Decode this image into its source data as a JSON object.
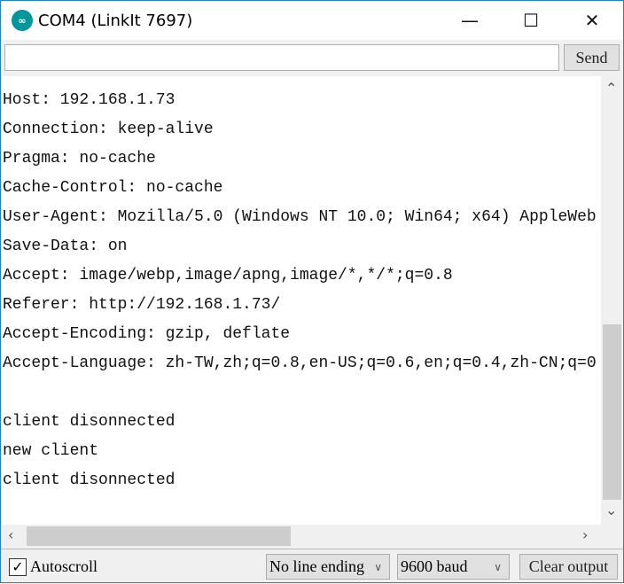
{
  "window": {
    "title": "COM4 (LinkIt 7697)",
    "logo_icon": "arduino-logo-icon",
    "accent": "#00979c"
  },
  "send_bar": {
    "input_value": "",
    "send_label": "Send"
  },
  "output": {
    "lines": [
      "Host: 192.168.1.73",
      "Connection: keep-alive",
      "Pragma: no-cache",
      "Cache-Control: no-cache",
      "User-Agent: Mozilla/5.0 (Windows NT 10.0; Win64; x64) AppleWeb",
      "Save-Data: on",
      "Accept: image/webp,image/apng,image/*,*/*;q=0.8",
      "Referer: http://192.168.1.73/",
      "Accept-Encoding: gzip, deflate",
      "Accept-Language: zh-TW,zh;q=0.8,en-US;q=0.6,en;q=0.4,zh-CN;q=0",
      "",
      "client disonnected",
      "new client",
      "client disonnected"
    ]
  },
  "footer": {
    "autoscroll_label": "Autoscroll",
    "autoscroll_checked": true,
    "line_ending": "No line ending",
    "baud": "9600 baud",
    "clear_label": "Clear output"
  }
}
